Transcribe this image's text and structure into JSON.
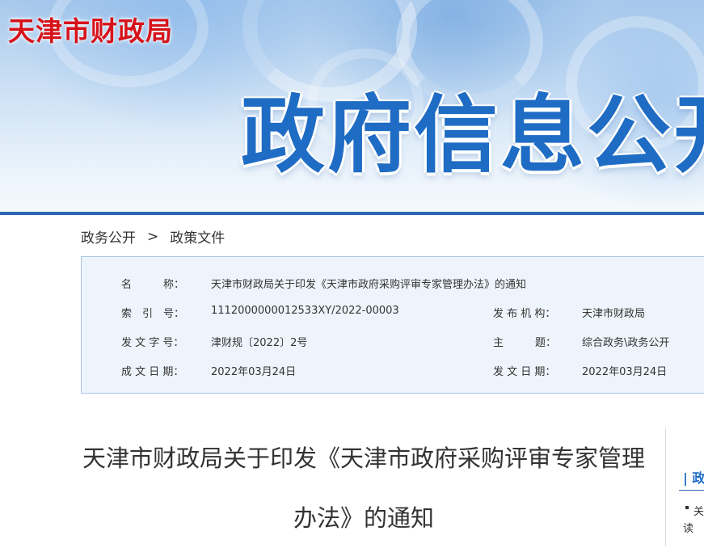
{
  "header": {
    "org_name": "天津市财政局",
    "banner_title": "政府信息公开"
  },
  "breadcrumb": {
    "items": [
      "政务公开",
      "政策文件"
    ],
    "separator": ">"
  },
  "info": {
    "name_label": "名　　　称：",
    "name_value": "天津市财政局关于印发《天津市政府采购评审专家管理办法》的通知",
    "index_label": "索　引　号：",
    "index_value": "1112000000012533XY/2022-00003",
    "publisher_label": "发 布 机 构：",
    "publisher_value": "天津市财政局",
    "docno_label": "发 文 字 号：",
    "docno_value": "津财规〔2022〕2号",
    "topic_label": "主　　　题：",
    "topic_value": "综合政务\\政务公开",
    "written_date_label": "成 文 日 期：",
    "written_date_value": "2022年03月24日",
    "publish_date_label": "发 文 日 期：",
    "publish_date_value": "2022年03月24日"
  },
  "article": {
    "title_line1": "天津市财政局关于印发《天津市政府采购评审专家管理",
    "title_line2": "办法》的通知"
  },
  "side_panel": {
    "heading": "| 政",
    "item_text": "关",
    "item_text2": "读"
  },
  "colors": {
    "brand_red": "#d7121a",
    "brand_blue": "#1f6cc4",
    "bar_blue": "#2a67b5",
    "info_bg": "#eef4fb",
    "info_border": "#a9c4e4"
  }
}
